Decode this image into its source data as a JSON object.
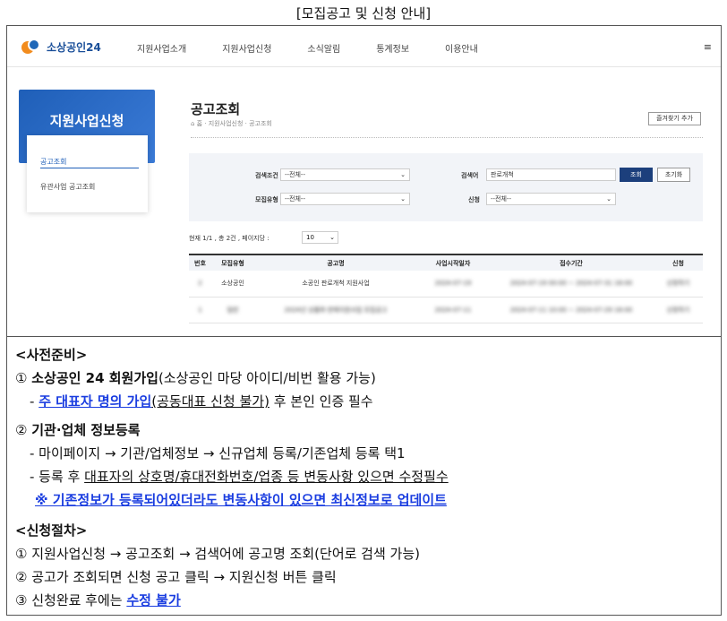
{
  "doc_title": "[모집공고 및 신청 안내]",
  "header": {
    "logo": "소상공인24",
    "nav": [
      "지원사업소개",
      "지원사업신청",
      "소식알림",
      "통계정보",
      "이용안내"
    ]
  },
  "sidebar": {
    "title": "지원사업신청",
    "items": [
      "공고조회",
      "유관사업 공고조회"
    ]
  },
  "content": {
    "title": "공고조회",
    "breadcrumb": "홈 · 지원사업신청 · 공고조회",
    "fav_button": "즐겨찾기 추가",
    "search": {
      "cond_label": "검색조건",
      "cond_value": "--전체--",
      "keyword_label": "검색어",
      "keyword_value": "판로개척",
      "search_button": "조회",
      "reset_button": "초기화",
      "type_label": "모집유형",
      "type_value": "--전체--",
      "apply_label": "신청",
      "apply_value": "--전체--"
    },
    "result_info": "현재 1/1 , 총 2건 , 페이지당 :",
    "page_size": "10",
    "table": {
      "headers": [
        "번호",
        "모집유형",
        "공고명",
        "사업시작일자",
        "접수기간",
        "신청"
      ],
      "rows": [
        [
          "2",
          "소상공인",
          "소공인 판로개척 지원사업",
          "2024-07-19",
          "2024-07-19 00:00 ~ 2024-07-31 18:00",
          "신청하기"
        ],
        [
          "1",
          "일반",
          "2024년 상품화·판매지원사업 모집공고",
          "2024-07-11",
          "2024-07-11 10:00 ~ 2024-07-29 18:00",
          "신청하기"
        ]
      ]
    }
  },
  "notes": {
    "prep_heading": "<사전준비>",
    "l1_num": "①",
    "l1_bold": "소상공인 24 회원가입",
    "l1_rest": "(소상공인 마당 아이디/비번 활용 가능)",
    "l2_dash": "-",
    "l2_blue": "주 대표자 명의 가입",
    "l2_u": "(공동대표 신청 불가)",
    "l2_rest": " 후 본인 인증 필수",
    "l3_num": "②",
    "l3_bold": "기관·업체 정보등록",
    "l4": "- 마이페이지 → 기관/업체정보 → 신규업체 등록/기존업체 등록 택1",
    "l5_pre": "- 등록 후 ",
    "l5_u": "대표자의 상호명/휴대전화번호/업종 등 변동사항 있으면 수정필수",
    "l6_blue": "※ 기존정보가 등록되어있더라도 변동사항이 있으면 최신정보로 업데이트",
    "proc_heading": "<신청절차>",
    "p1": "① 지원사업신청 → 공고조회 → 검색어에 공고명 조회(단어로 검색 가능)",
    "p2": "② 공고가 조회되면 신청 공고 클릭 → 지원신청 버튼 클릭",
    "p3_pre": "③ 신청완료 후에는 ",
    "p3_blue": "수정 불가"
  },
  "colors": {
    "brand_blue": "#1f5fb8",
    "navy_button": "#1c3f7c",
    "link_blue": "#1a3de0",
    "logo_orange": "#f28c1e"
  }
}
